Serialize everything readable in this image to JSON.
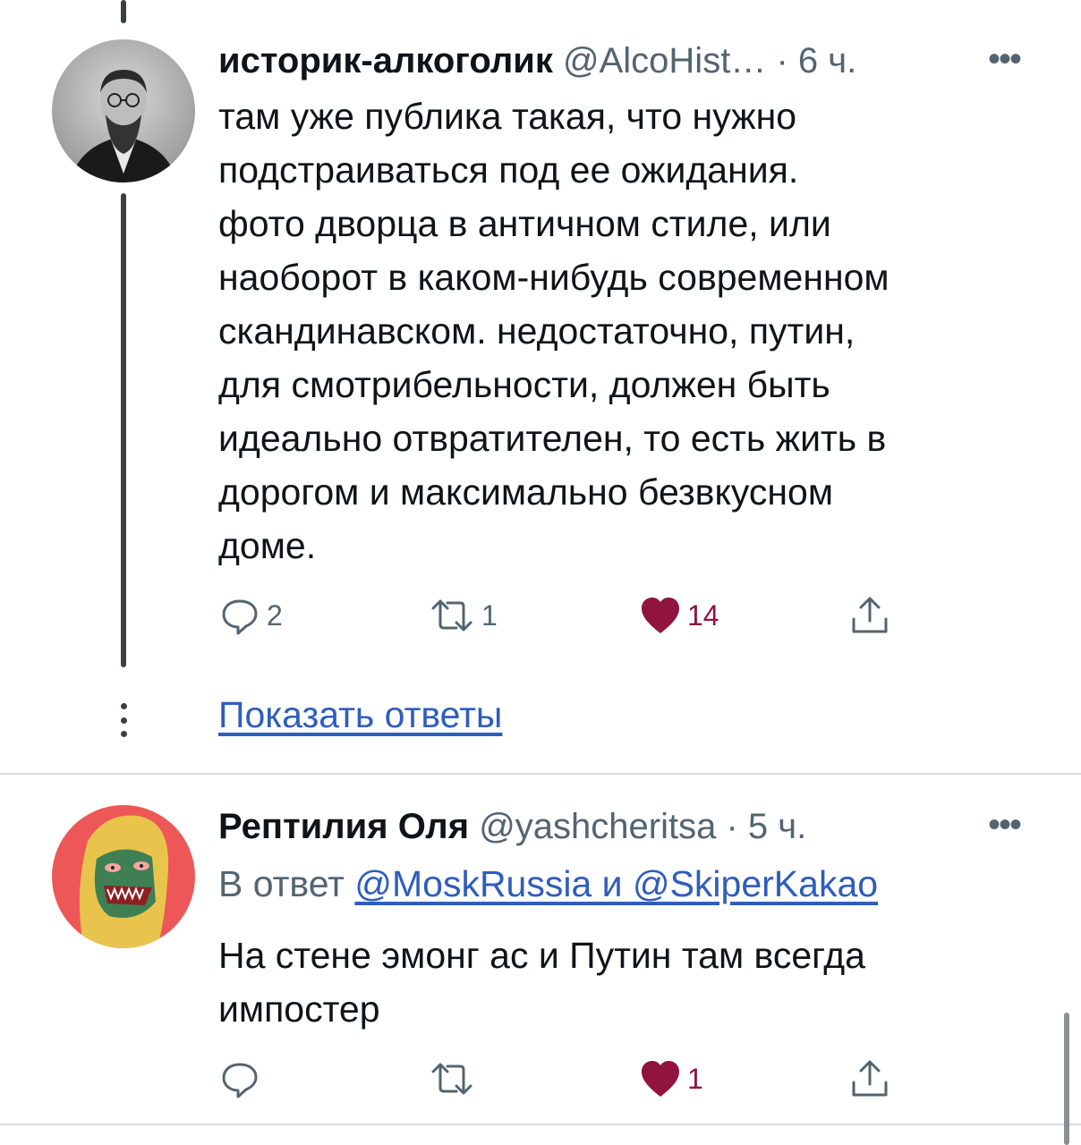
{
  "tweet1": {
    "name": "историк-алкоголик",
    "handle": "@AlcoHist…",
    "dot": "·",
    "time": "6 ч.",
    "text": "там уже публика такая, что нужно\nподстраиваться под ее ожидания.\nфото дворца в античном стиле, или\nнаоборот в каком-нибудь современном\nскандинавском. недостаточно, путин,\nдля смотрибельности, должен быть\nидеально отвратителен, то есть жить в\nдорогом и максимально безвкусном\nдоме.",
    "replies": "2",
    "retweets": "1",
    "likes": "14",
    "more": "•••"
  },
  "show_replies": "Показать ответы",
  "tweet2": {
    "name": "Рептилия Оля",
    "handle": "@yashcheritsa",
    "dot": "·",
    "time": "5 ч.",
    "reply_prefix": "В ответ",
    "reply_mentions": "@MoskRussia и @SkiperKakao",
    "text": "На стене эмонг ас и Путин там всегда\nимпостер",
    "likes": "1",
    "more": "•••"
  },
  "colors": {
    "like": "#91143f",
    "link": "#2f5dbd",
    "muted": "#536471",
    "thread": "#3a3f44"
  },
  "icons": [
    "reply-icon",
    "retweet-icon",
    "like-icon",
    "share-icon",
    "more-icon"
  ]
}
